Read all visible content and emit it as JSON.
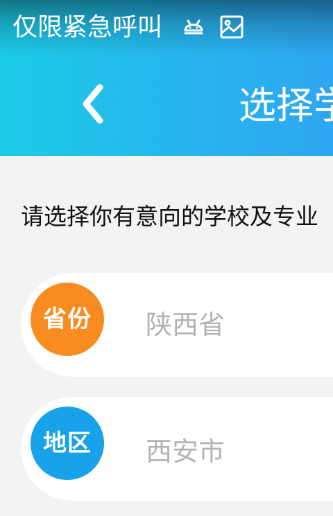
{
  "status_bar": {
    "text": "仅限紧急呼叫",
    "icons": [
      "android-icon",
      "image-icon"
    ]
  },
  "nav": {
    "back_icon": "chevron-left-icon",
    "title": "选择学"
  },
  "prompt": "请选择你有意向的学校及专业",
  "options": [
    {
      "badge": "省份",
      "value": "陕西省",
      "badge_color": "#f98c20"
    },
    {
      "badge": "地区",
      "value": "西安市",
      "badge_color": "#17a2e9"
    }
  ],
  "colors": {
    "header_start": "#1ccbe6",
    "header_end": "#2ea6f1",
    "background": "#f4f3f4"
  }
}
